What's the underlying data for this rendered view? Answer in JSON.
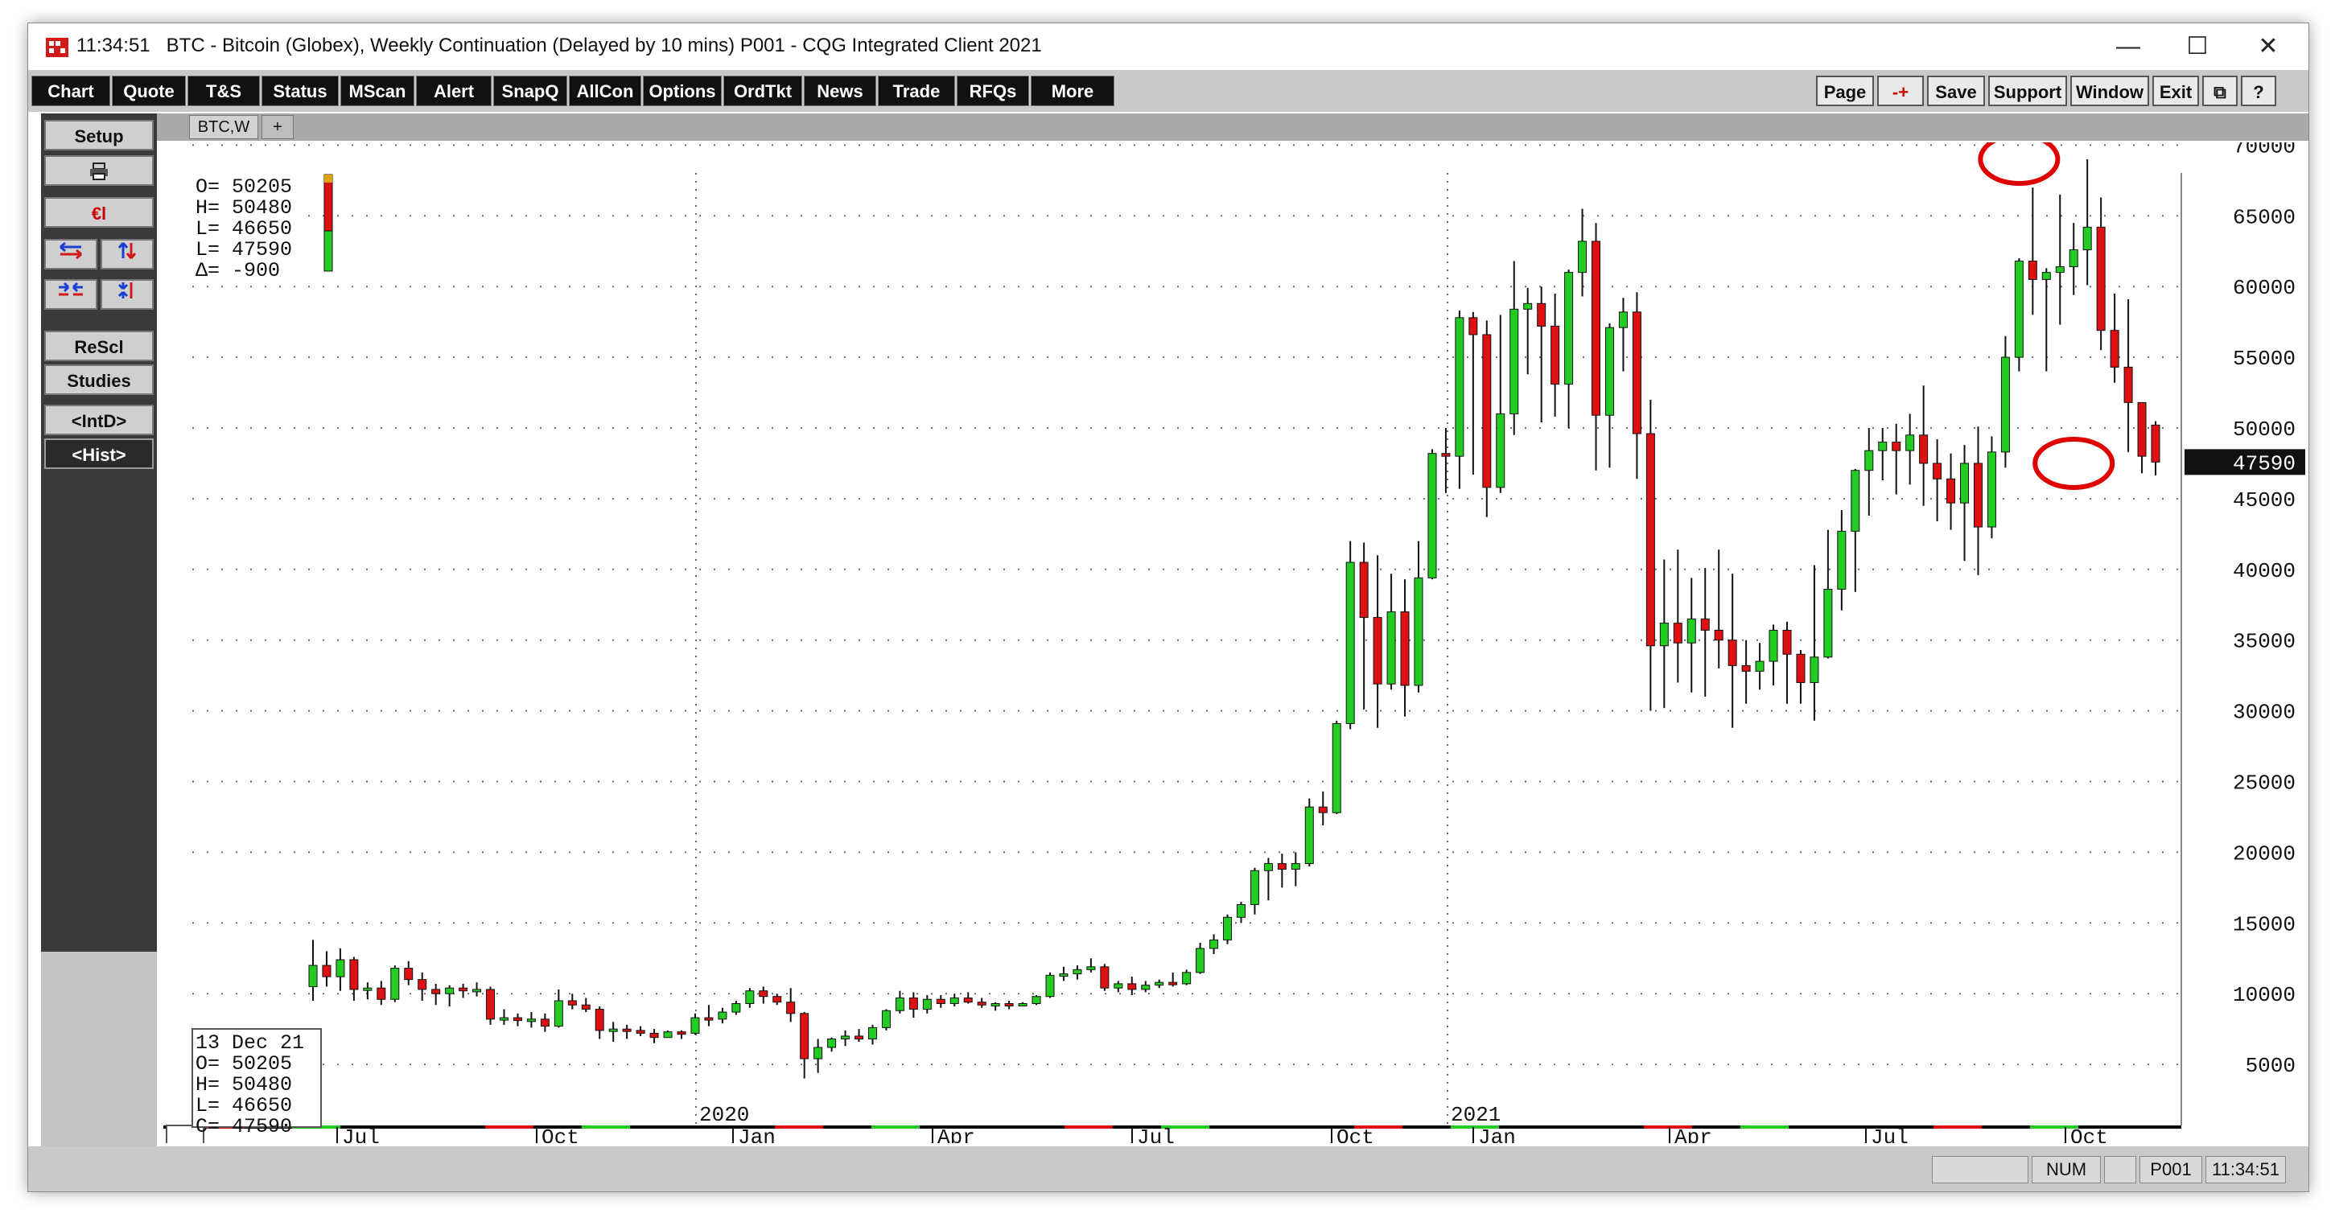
{
  "window": {
    "time": "11:34:51",
    "title": "BTC - Bitcoin (Globex), Weekly Continuation (Delayed by 10 mins)   P001 - CQG Integrated Client 2021",
    "minimize_label": "—",
    "maximize_label": "☐",
    "close_label": "✕"
  },
  "toolbar": {
    "left": [
      "Chart",
      "Quote",
      "T&S",
      "Status",
      "MScan",
      "Alert",
      "SnapQ",
      "AllCon",
      "Options",
      "OrdTkt",
      "News",
      "Trade",
      "RFQs",
      "More"
    ],
    "right": [
      "Page",
      "-+",
      "Save",
      "Support",
      "Window",
      "Exit",
      "⧉",
      "?"
    ]
  },
  "left_panel": {
    "setup": "Setup",
    "print_icon": "printer-icon",
    "el_label": "€l",
    "rescl": "ReScl",
    "studies": "Studies",
    "intd": "<IntD>",
    "hist": "<Hist>"
  },
  "tabs": {
    "active": "BTC,W",
    "add": "+"
  },
  "ohlc_top": {
    "lines": [
      "O=   50205",
      "H=   50480",
      "L=   46650",
      "L=   47590",
      "Δ=    -900"
    ]
  },
  "ohlc_bottom": {
    "date": "13 Dec 21",
    "lines": [
      "O=   50205",
      "H=   50480",
      "L=   46650",
      "C=   47590"
    ]
  },
  "last_price_label": "47590",
  "colors": {
    "up": "#22cc22",
    "down": "#dd1111",
    "circle": "#e00000",
    "grid": "#6a6a6a"
  },
  "chart_data": {
    "type": "candlestick",
    "y_ticks": [
      5000,
      10000,
      15000,
      20000,
      25000,
      30000,
      35000,
      40000,
      45000,
      50000,
      55000,
      60000,
      65000,
      70000
    ],
    "ylim": [
      0,
      70000
    ],
    "x_ticks": [
      "Jul",
      "Oct",
      "Jan",
      "Apr",
      "Jul",
      "Oct",
      "Jan",
      "Apr",
      "Jul",
      "Oct"
    ],
    "year_labels": [
      "2020",
      "2021"
    ],
    "last_price": 47590,
    "candles": [
      [
        10500,
        13800,
        9500,
        12000
      ],
      [
        12000,
        13000,
        10500,
        11200
      ],
      [
        11200,
        13200,
        10200,
        12400
      ],
      [
        12400,
        12600,
        9500,
        10300
      ],
      [
        10300,
        10800,
        9600,
        10400
      ],
      [
        10400,
        10900,
        9200,
        9600
      ],
      [
        9600,
        12000,
        9400,
        11800
      ],
      [
        11800,
        12300,
        10600,
        11000
      ],
      [
        11000,
        11500,
        9500,
        10300
      ],
      [
        10300,
        10700,
        9200,
        10000
      ],
      [
        10000,
        10600,
        9100,
        10400
      ],
      [
        10400,
        10700,
        9700,
        10200
      ],
      [
        10200,
        10800,
        9800,
        10300
      ],
      [
        10300,
        10500,
        7800,
        8200
      ],
      [
        8200,
        8900,
        7800,
        8300
      ],
      [
        8300,
        8600,
        7700,
        8100
      ],
      [
        8100,
        8700,
        7600,
        8200
      ],
      [
        8200,
        8600,
        7300,
        7700
      ],
      [
        7700,
        10300,
        7600,
        9500
      ],
      [
        9500,
        10000,
        8900,
        9200
      ],
      [
        9200,
        9700,
        8700,
        8900
      ],
      [
        8900,
        9100,
        6800,
        7400
      ],
      [
        7400,
        8000,
        6600,
        7500
      ],
      [
        7500,
        7800,
        6800,
        7400
      ],
      [
        7400,
        7700,
        7000,
        7200
      ],
      [
        7200,
        7500,
        6500,
        6900
      ],
      [
        6900,
        7400,
        6900,
        7300
      ],
      [
        7300,
        7400,
        6800,
        7200
      ],
      [
        7200,
        8600,
        7100,
        8300
      ],
      [
        8300,
        9200,
        7700,
        8200
      ],
      [
        8200,
        9000,
        7900,
        8700
      ],
      [
        8700,
        9500,
        8500,
        9300
      ],
      [
        9300,
        10400,
        9000,
        10200
      ],
      [
        10200,
        10500,
        9300,
        9800
      ],
      [
        9800,
        10000,
        9200,
        9400
      ],
      [
        9400,
        10400,
        8000,
        8600
      ],
      [
        8600,
        8700,
        4000,
        5400
      ],
      [
        5400,
        6800,
        4400,
        6200
      ],
      [
        6200,
        6900,
        5900,
        6800
      ],
      [
        6800,
        7400,
        6300,
        7000
      ],
      [
        7000,
        7500,
        6600,
        6800
      ],
      [
        6800,
        7800,
        6400,
        7600
      ],
      [
        7600,
        8900,
        7400,
        8800
      ],
      [
        8800,
        10200,
        8600,
        9700
      ],
      [
        9700,
        10100,
        8300,
        8900
      ],
      [
        8900,
        9900,
        8600,
        9600
      ],
      [
        9600,
        9900,
        9000,
        9300
      ],
      [
        9300,
        10000,
        9100,
        9700
      ],
      [
        9700,
        10100,
        9300,
        9400
      ],
      [
        9400,
        9700,
        9000,
        9200
      ],
      [
        9200,
        9400,
        8800,
        9300
      ],
      [
        9300,
        9500,
        8900,
        9200
      ],
      [
        9200,
        9400,
        9100,
        9300
      ],
      [
        9300,
        9900,
        9200,
        9800
      ],
      [
        9800,
        11500,
        9700,
        11300
      ],
      [
        11300,
        11900,
        10900,
        11400
      ],
      [
        11400,
        12000,
        11000,
        11700
      ],
      [
        11700,
        12500,
        11500,
        11900
      ],
      [
        11900,
        12100,
        10200,
        10400
      ],
      [
        10400,
        10900,
        10100,
        10700
      ],
      [
        10700,
        11200,
        9900,
        10300
      ],
      [
        10300,
        10900,
        10100,
        10600
      ],
      [
        10600,
        11000,
        10400,
        10800
      ],
      [
        10800,
        11500,
        10500,
        10700
      ],
      [
        10700,
        11700,
        10600,
        11500
      ],
      [
        11500,
        13600,
        11400,
        13200
      ],
      [
        13200,
        14200,
        12800,
        13800
      ],
      [
        13800,
        15600,
        13500,
        15400
      ],
      [
        15400,
        16500,
        15000,
        16300
      ],
      [
        16300,
        18900,
        15600,
        18700
      ],
      [
        18700,
        19600,
        16600,
        19200
      ],
      [
        19200,
        19900,
        17500,
        18800
      ],
      [
        18800,
        20000,
        17600,
        19200
      ],
      [
        19200,
        23800,
        19000,
        23200
      ],
      [
        23200,
        24300,
        21900,
        22800
      ],
      [
        22800,
        29300,
        22700,
        29100
      ],
      [
        29100,
        42000,
        28700,
        40500
      ],
      [
        40500,
        41900,
        30100,
        36600
      ],
      [
        36600,
        41000,
        28800,
        31900
      ],
      [
        31900,
        39700,
        31500,
        37000
      ],
      [
        37000,
        39300,
        29600,
        31800
      ],
      [
        31800,
        42000,
        31300,
        39400
      ],
      [
        39400,
        48500,
        39300,
        48200
      ],
      [
        48200,
        50000,
        45400,
        48000
      ],
      [
        48000,
        58300,
        45700,
        57800
      ],
      [
        57800,
        58200,
        46700,
        56600
      ],
      [
        56600,
        57600,
        43700,
        45800
      ],
      [
        45800,
        58000,
        45400,
        51000
      ],
      [
        51000,
        61800,
        49500,
        58400
      ],
      [
        58400,
        59900,
        53800,
        58800
      ],
      [
        58800,
        60000,
        50400,
        57200
      ],
      [
        57200,
        59500,
        50800,
        53100
      ],
      [
        53100,
        61200,
        50000,
        61000
      ],
      [
        61000,
        65500,
        59300,
        63200
      ],
      [
        63200,
        64500,
        47000,
        50900
      ],
      [
        50900,
        57400,
        47200,
        57100
      ],
      [
        57100,
        59200,
        54000,
        58200
      ],
      [
        58200,
        59600,
        46400,
        49600
      ],
      [
        49600,
        52000,
        30000,
        34600
      ],
      [
        34600,
        40700,
        30200,
        36200
      ],
      [
        36200,
        41400,
        32000,
        34800
      ],
      [
        34800,
        39400,
        31300,
        36500
      ],
      [
        36500,
        40100,
        31000,
        35700
      ],
      [
        35700,
        41400,
        33000,
        35000
      ],
      [
        35000,
        39700,
        28800,
        33200
      ],
      [
        33200,
        35000,
        30500,
        32800
      ],
      [
        32800,
        34800,
        31500,
        33500
      ],
      [
        33500,
        36100,
        31800,
        35700
      ],
      [
        35700,
        36300,
        30500,
        34000
      ],
      [
        34000,
        34300,
        30500,
        32000
      ],
      [
        32000,
        40300,
        29300,
        33800
      ],
      [
        33800,
        42800,
        33700,
        38600
      ],
      [
        38600,
        44200,
        37100,
        42700
      ],
      [
        42700,
        47100,
        38400,
        47000
      ],
      [
        47000,
        50000,
        43800,
        48400
      ],
      [
        48400,
        50000,
        46300,
        49000
      ],
      [
        49000,
        50300,
        45300,
        48400
      ],
      [
        48400,
        51000,
        46000,
        49500
      ],
      [
        49500,
        53000,
        44500,
        47500
      ],
      [
        47500,
        49200,
        43400,
        46400
      ],
      [
        46400,
        48200,
        42800,
        44700
      ],
      [
        44700,
        48800,
        40600,
        47500
      ],
      [
        47500,
        50100,
        39600,
        43000
      ],
      [
        43000,
        49400,
        42200,
        48300
      ],
      [
        48300,
        56500,
        47200,
        55000
      ],
      [
        55000,
        62000,
        54000,
        61800
      ],
      [
        61800,
        67000,
        58000,
        60500
      ],
      [
        60500,
        61300,
        54000,
        61000
      ],
      [
        61000,
        66500,
        57300,
        61400
      ],
      [
        61400,
        64500,
        59400,
        62600
      ],
      [
        62600,
        69000,
        60100,
        64200
      ],
      [
        64200,
        66300,
        55500,
        56900
      ],
      [
        56900,
        59500,
        53200,
        54300
      ],
      [
        54300,
        59100,
        48300,
        51800
      ],
      [
        51800,
        50800,
        46800,
        48000
      ],
      [
        50205,
        50480,
        46650,
        47590
      ]
    ],
    "annotations": [
      {
        "type": "circle",
        "x_index": 125,
        "y": 69000
      },
      {
        "type": "circle",
        "x_index": 129,
        "y": 47500
      }
    ]
  }
}
